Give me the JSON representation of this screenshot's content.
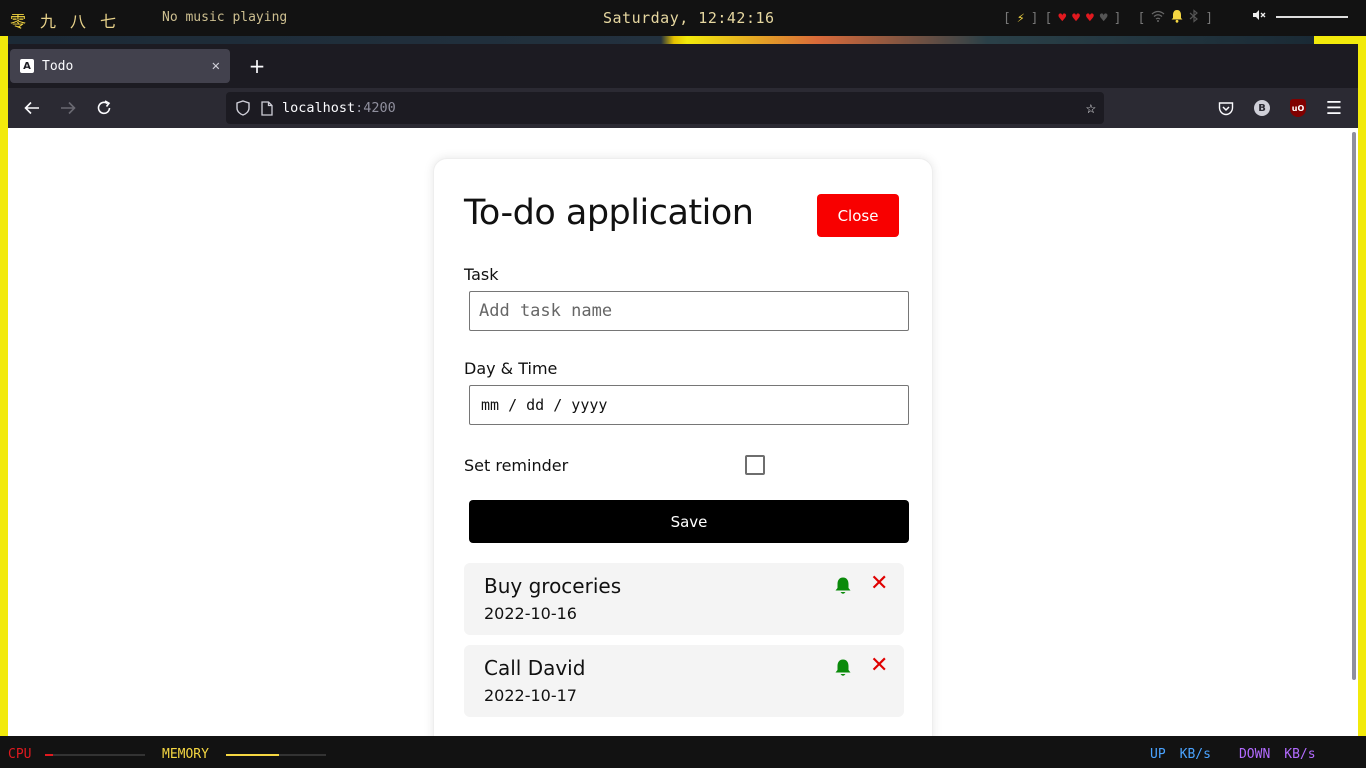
{
  "topbar": {
    "workspaces": [
      "零",
      "九",
      "八",
      "七"
    ],
    "music": "No music playing",
    "clock": "Saturday, 12:42:16",
    "hearts_full": 3,
    "hearts_total": 4
  },
  "browser": {
    "tab_title": "Todo",
    "tab_icon": "A",
    "url_host": "localhost",
    "url_port": ":4200"
  },
  "app": {
    "title": "To-do application",
    "close_label": "Close",
    "task_label": "Task",
    "task_placeholder": "Add task name",
    "datetime_label": "Day & Time",
    "date_value": "mm / dd / yyyy",
    "reminder_label": "Set reminder",
    "reminder_checked": false,
    "save_label": "Save",
    "todos": [
      {
        "title": "Buy groceries",
        "date": "2022-10-16",
        "reminder": true
      },
      {
        "title": "Call David",
        "date": "2022-10-17",
        "reminder": true
      }
    ],
    "colors": {
      "close": "#f80000",
      "save": "#000000",
      "bell": "#0a8a0a",
      "delete": "#e00000"
    }
  },
  "bottombar": {
    "cpu_label": "CPU",
    "cpu_level": 0.08,
    "memory_label": "MEMORY",
    "memory_level": 0.53,
    "up_label": "UP",
    "up_unit": "KB/s",
    "down_label": "DOWN",
    "down_unit": "KB/s"
  }
}
